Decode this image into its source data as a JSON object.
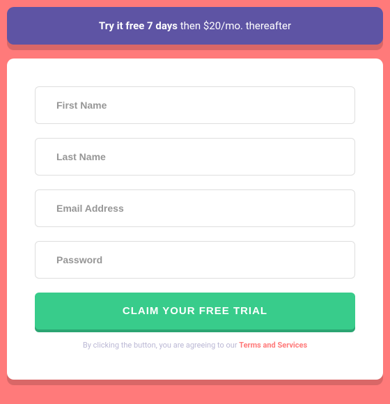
{
  "banner": {
    "bold": "Try it free 7 days",
    "rest": " then $20/mo. thereafter"
  },
  "form": {
    "firstName": {
      "placeholder": "First Name",
      "value": ""
    },
    "lastName": {
      "placeholder": "Last Name",
      "value": ""
    },
    "email": {
      "placeholder": "Email Address",
      "value": ""
    },
    "password": {
      "placeholder": "Password",
      "value": ""
    },
    "submitLabel": "CLAIM YOUR FREE TRIAL"
  },
  "terms": {
    "prefix": "By clicking the button, you are agreeing to our ",
    "linkText": "Terms and Services"
  }
}
